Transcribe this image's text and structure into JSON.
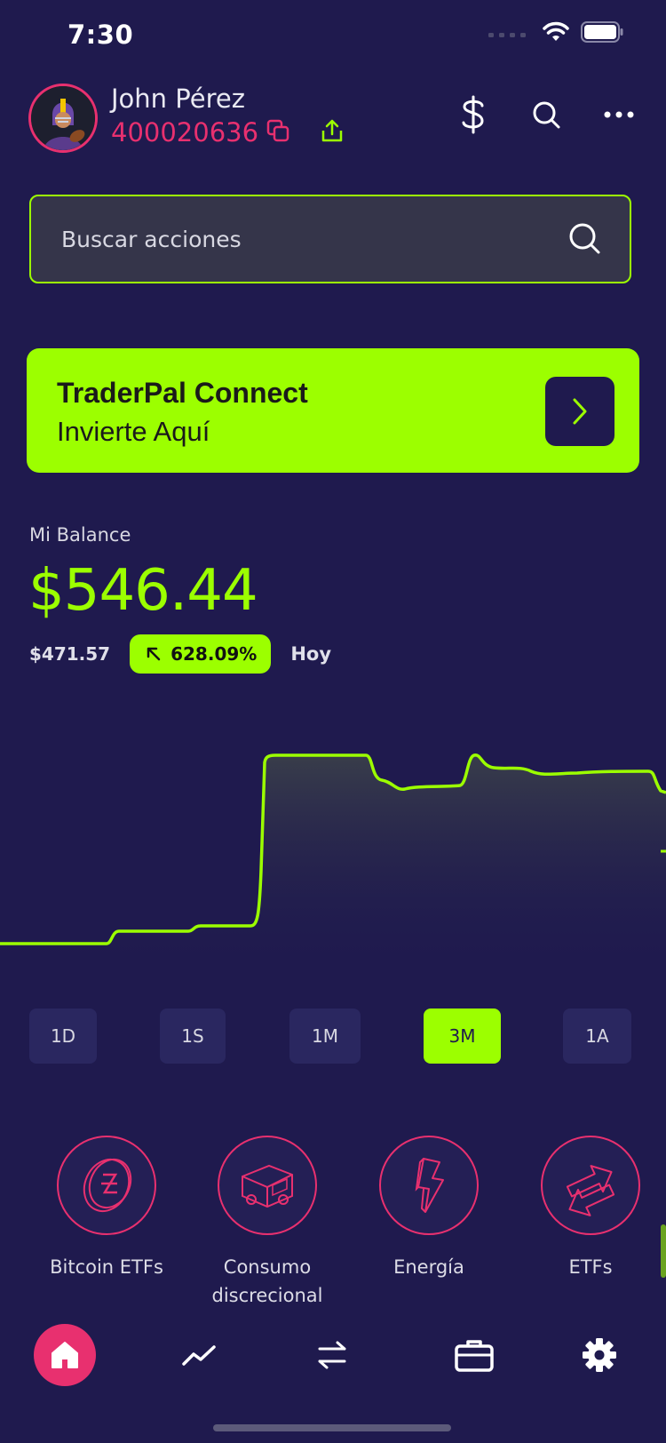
{
  "status_bar": {
    "time": "7:30"
  },
  "header": {
    "user_name": "John Pérez",
    "account_id": "400020636"
  },
  "search": {
    "placeholder": "Buscar acciones",
    "value": ""
  },
  "promo": {
    "title": "TraderPal Connect",
    "subtitle": "Invierte Aquí"
  },
  "balance": {
    "label": "Mi Balance",
    "value": "$546.44",
    "previous": "$471.57",
    "change": "628.09%",
    "period": "Hoy"
  },
  "ranges": {
    "items": [
      "1D",
      "1S",
      "1M",
      "3M",
      "1A"
    ],
    "selected": "3M"
  },
  "categories": [
    {
      "label": "Bitcoin ETFs",
      "icon": "bitcoin-coin-icon"
    },
    {
      "label": "Consumo discrecional",
      "icon": "delivery-truck-icon"
    },
    {
      "label": "Energía",
      "icon": "lightning-bolt-icon"
    },
    {
      "label": "ETFs",
      "icon": "arrows-exchange-icon"
    }
  ],
  "tabs": [
    {
      "name": "home",
      "icon": "home-icon",
      "active": true
    },
    {
      "name": "markets",
      "icon": "trend-line-icon"
    },
    {
      "name": "transfers",
      "icon": "transfer-arrows-icon"
    },
    {
      "name": "portfolio",
      "icon": "briefcase-icon"
    },
    {
      "name": "settings",
      "icon": "gear-icon"
    }
  ],
  "colors": {
    "background": "#1f1a4e",
    "accent": "#9cff00",
    "pink": "#e8306f"
  }
}
